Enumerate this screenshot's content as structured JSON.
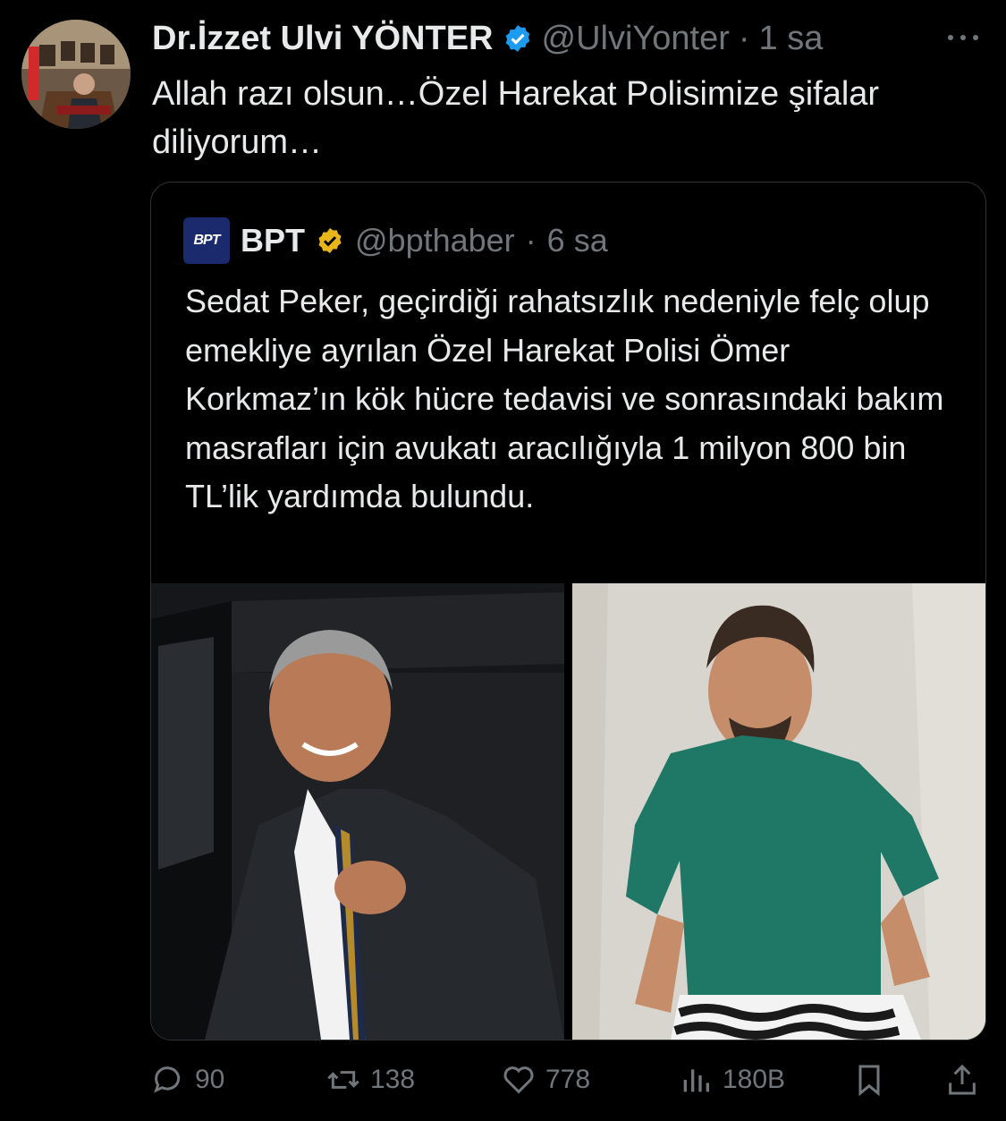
{
  "tweet": {
    "author_name": "Dr.İzzet Ulvi YÖNTER",
    "handle": "@UlviYonter",
    "separator": "·",
    "time": "1 sa",
    "text": "Allah razı olsun…Özel Harekat Polisimize şifalar diliyorum…",
    "verified_color": "#1d9bf0",
    "avatar_icon": "profile-photo"
  },
  "quote": {
    "logo_text": "BPT",
    "author_name": "BPT",
    "handle": "@bpthaber",
    "separator": "·",
    "time": "6 sa",
    "text": "Sedat Peker, geçirdiği rahatsızlık nedeniyle felç olup emekliye ayrılan Özel Harekat Polisi Ömer Korkmaz’ın kök hücre tedavisi ve sonrasındaki bakım masrafları için avukatı aracılığıyla 1 milyon 800 bin TL’lik yardımda bulundu.",
    "verified_color": "#e8b61a",
    "images": [
      "man-in-suit-photo",
      "man-in-green-shirt-photo"
    ]
  },
  "actions": {
    "replies": "90",
    "reposts": "138",
    "likes": "778",
    "views": "180B"
  },
  "colors": {
    "background": "#000000",
    "text": "#e7e9ea",
    "muted": "#71767b",
    "border": "#2f3336"
  }
}
